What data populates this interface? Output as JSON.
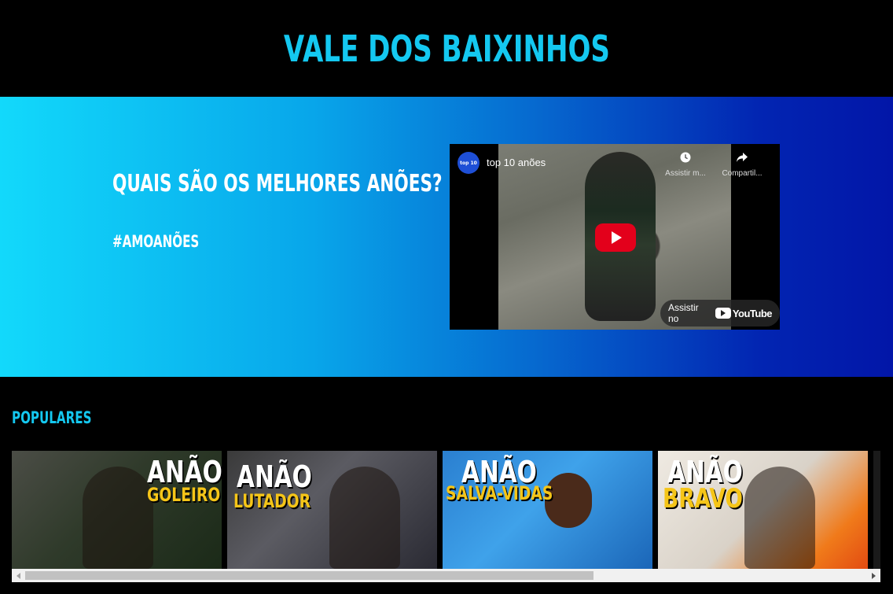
{
  "header": {
    "title": "VALE DOS BAIXINHOS"
  },
  "hero": {
    "question": "QUAIS SÃO OS MELHORES ANÕES?",
    "hashtag": "#AMOANÕES"
  },
  "video": {
    "channel_avatar_text": "top 10",
    "title": "top 10 anões",
    "watch_later_label": "Assistir m...",
    "watch_later_icon": "clock-icon",
    "share_label": "Compartil...",
    "share_icon": "share-arrow-icon",
    "watch_on_label": "Assistir no",
    "youtube_label": "YouTube",
    "play_button_color": "#e3001b"
  },
  "popular": {
    "heading": "POPULARES",
    "thumbnails": [
      {
        "title": "ANÃO",
        "subtitle": "GOLEIRO"
      },
      {
        "title": "ANÃO",
        "subtitle": "LUTADOR"
      },
      {
        "title": "ANÃO",
        "subtitle": "SALVA-VIDAS"
      },
      {
        "title": "ANÃO",
        "subtitle": "BRAVO"
      }
    ]
  },
  "scroll": {
    "position_fraction": 0.0,
    "visible_fraction": 0.67
  },
  "colors": {
    "accent": "#14c8f0",
    "hero_gradient_start": "#12d9fb",
    "hero_gradient_end": "#0216a8",
    "thumbnail_subtitle": "#f5c518"
  }
}
